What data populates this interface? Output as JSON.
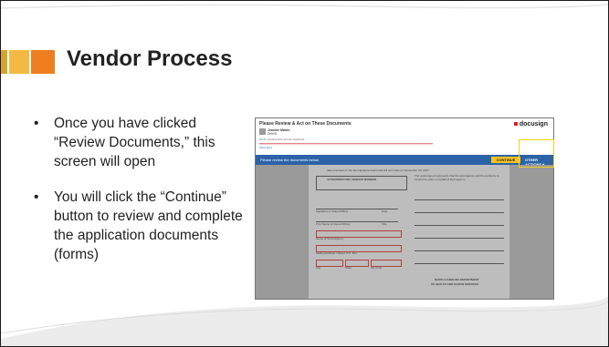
{
  "slide": {
    "title": "Vendor Process",
    "bullets": [
      "Once you have clicked “Review Documents,” this screen will open",
      "You will click the “Continue” button to review and complete the application documents (forms)"
    ]
  },
  "screenshot": {
    "header_title": "Please Review & Act on These Documents",
    "brand": "docusign",
    "sender_name": "Jeanine Martin",
    "sender_detail": "DHHS",
    "subject": "North Carolina WIC Vendor Applicant",
    "showmore": "Show More",
    "bluebar_text": "Please review the documents below.",
    "continue_label": "CONTINUE",
    "other_actions_label": "OTHER ACTIONS ▾",
    "page": {
      "intro_text": "date executed on the last signature below and will terminate on September 30, 2027.",
      "box_heading": "AUTHORIZED WIC VENDOR NUMBER",
      "agreement_text": "The undersigned represents that the local agency and the authority to commit its entity on behalf of their agency.",
      "sig_label": "Signature of Owner/Officer",
      "date_label": "Date",
      "print_label": "Print Name of Owner/Officer",
      "title_label": "Title",
      "store_label": "Name of Store/Agency",
      "street_label": "Mailing Address / Street, P.O. Box",
      "city_label": "City",
      "state_label": "State",
      "zip_label": "Zip Code",
      "dept_line1": "NORTH CAROLINA DEPARTMENT",
      "dept_line2": "OF HEALTH AND HUMAN SERVICES"
    }
  },
  "colors": {
    "accent_orange": "#ee7d1f",
    "accent_amber": "#f4b943",
    "accent_gold": "#d4a52d",
    "docusign_blue": "#2c63a8",
    "continue_yellow": "#f4c321",
    "highlight": "#f0d21a"
  }
}
